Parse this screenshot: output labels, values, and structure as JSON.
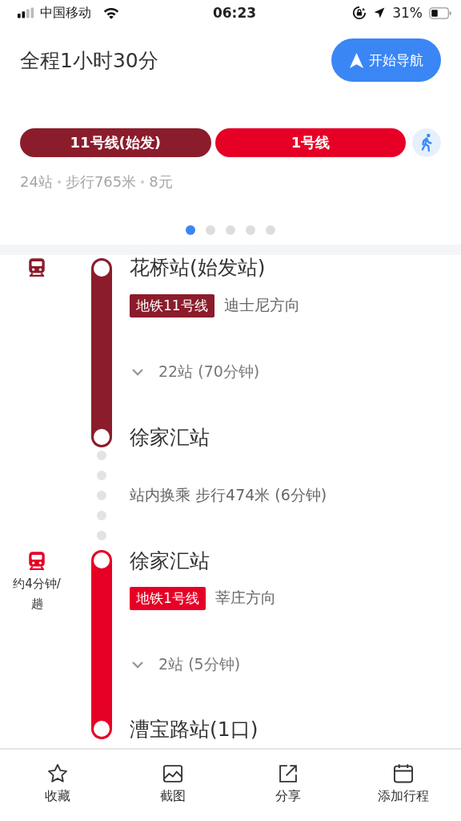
{
  "status_bar": {
    "carrier": "中国移动",
    "time": "06:23",
    "battery": "31%"
  },
  "header": {
    "title": "全程1小时30分",
    "nav_button": "开始导航"
  },
  "route_lines": [
    {
      "kind": "transit",
      "label": "11号线(始发)",
      "color": "#8b1c2b"
    },
    {
      "kind": "transit",
      "label": "1号线",
      "color": "#e60026"
    },
    {
      "kind": "walk"
    }
  ],
  "summary": [
    "24站",
    "步行765米",
    "8元"
  ],
  "pager": [
    {
      "selected": true
    },
    {
      "selected": false
    },
    {
      "selected": false
    },
    {
      "selected": false
    },
    {
      "selected": false
    }
  ],
  "steps": [
    {
      "kind": "transit",
      "color": "#8b1c2b",
      "from": "花桥站(始发站)",
      "line": "地铁11号线",
      "direction": "迪士尼方向",
      "stops": "22站 (70分钟)",
      "expanded": false,
      "to": "徐家汇站"
    },
    {
      "kind": "transfer",
      "text": "站内换乘 步行474米 (6分钟)"
    },
    {
      "kind": "transit",
      "color": "#e60026",
      "frequency": "约4分钟/趟",
      "from": "徐家汇站",
      "line": "地铁1号线",
      "direction": "莘庄方向",
      "stops": "2站 (5分钟)",
      "expanded": false,
      "to": "漕宝路站(1口)"
    }
  ],
  "toolbar": [
    {
      "kind": "star",
      "label": "收藏"
    },
    {
      "kind": "image",
      "label": "截图"
    },
    {
      "kind": "share",
      "label": "分享"
    },
    {
      "kind": "calendar",
      "label": "添加行程"
    }
  ]
}
